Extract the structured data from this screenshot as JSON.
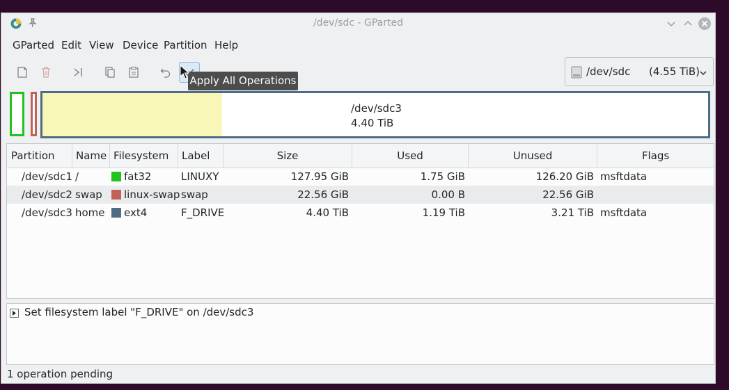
{
  "window": {
    "title": "/dev/sdc - GParted"
  },
  "menu": [
    "GParted",
    "Edit",
    "View",
    "Device",
    "Partition",
    "Help"
  ],
  "toolbar": {
    "buttons": [
      {
        "name": "new-partition-icon"
      },
      {
        "name": "delete-partition-icon"
      },
      {
        "name": "resize-move-icon"
      },
      {
        "name": "copy-icon"
      },
      {
        "name": "paste-icon"
      },
      {
        "name": "undo-icon"
      },
      {
        "name": "apply-icon"
      }
    ],
    "tooltip": "Apply All Operations"
  },
  "device": {
    "name": "/dev/sdc",
    "size": "(4.55 TiB)"
  },
  "diskmap": {
    "partition": "/dev/sdc3",
    "size": "4.40 TiB",
    "used_fraction": 0.27
  },
  "table": {
    "headers": [
      "Partition",
      "Name",
      "Filesystem",
      "Label",
      "Size",
      "Used",
      "Unused",
      "Flags"
    ],
    "rows": [
      {
        "partition": "/dev/sdc1",
        "name": "/",
        "filesystem": "fat32",
        "fs_color": "#21c321",
        "label": "LINUXY",
        "size": "127.95 GiB",
        "used": "1.75 GiB",
        "unused": "126.20 GiB",
        "flags": "msftdata"
      },
      {
        "partition": "/dev/sdc2",
        "name": "swap",
        "filesystem": "linux-swap",
        "fs_color": "#c0625a",
        "label": "swap",
        "size": "22.56 GiB",
        "used": "0.00 B",
        "unused": "22.56 GiB",
        "flags": ""
      },
      {
        "partition": "/dev/sdc3",
        "name": "home",
        "filesystem": "ext4",
        "fs_color": "#4f6c86",
        "label": "F_DRIVE",
        "size": "4.40 TiB",
        "used": "1.19 TiB",
        "unused": "3.21 TiB",
        "flags": "msftdata"
      }
    ]
  },
  "operations": [
    "Set filesystem label \"F_DRIVE\" on /dev/sdc3"
  ],
  "status": "1 operation pending"
}
